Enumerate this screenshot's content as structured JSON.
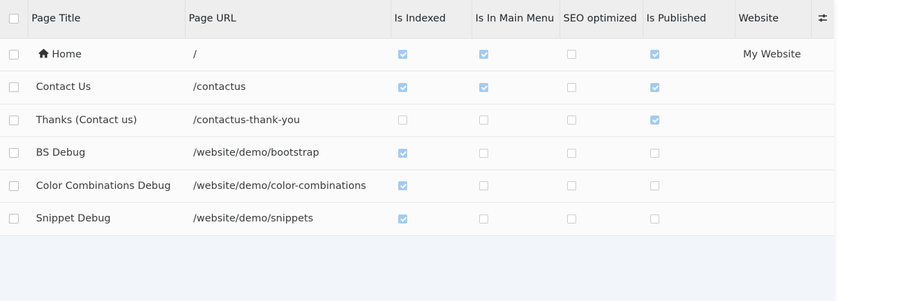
{
  "columns": {
    "title": "Page Title",
    "url": "Page URL",
    "indexed": "Is Indexed",
    "main_menu": "Is In Main Menu",
    "seo": "SEO optimized",
    "published": "Is Published",
    "website": "Website"
  },
  "icons": {
    "home": "home-icon",
    "options": "settings-sliders-icon"
  },
  "colors": {
    "checked": "#a3cbf0",
    "panel_bg": "#f2f6fa",
    "header_bg": "#eeeeee"
  },
  "rows": [
    {
      "title": "Home",
      "url": "/",
      "indexed": true,
      "main_menu": true,
      "seo": false,
      "published": true,
      "website": "My Website"
    },
    {
      "title": "Contact Us",
      "url": "/contactus",
      "indexed": true,
      "main_menu": true,
      "seo": false,
      "published": true,
      "website": ""
    },
    {
      "title": "Thanks (Contact us)",
      "url": "/contactus-thank-you",
      "indexed": false,
      "main_menu": false,
      "seo": false,
      "published": true,
      "website": ""
    },
    {
      "title": "BS Debug",
      "url": "/website/demo/bootstrap",
      "indexed": true,
      "main_menu": false,
      "seo": false,
      "published": false,
      "website": ""
    },
    {
      "title": "Color Combinations Debug",
      "url": "/website/demo/color-combinations",
      "indexed": true,
      "main_menu": false,
      "seo": false,
      "published": false,
      "website": ""
    },
    {
      "title": "Snippet Debug",
      "url": "/website/demo/snippets",
      "indexed": true,
      "main_menu": false,
      "seo": false,
      "published": false,
      "website": ""
    }
  ]
}
